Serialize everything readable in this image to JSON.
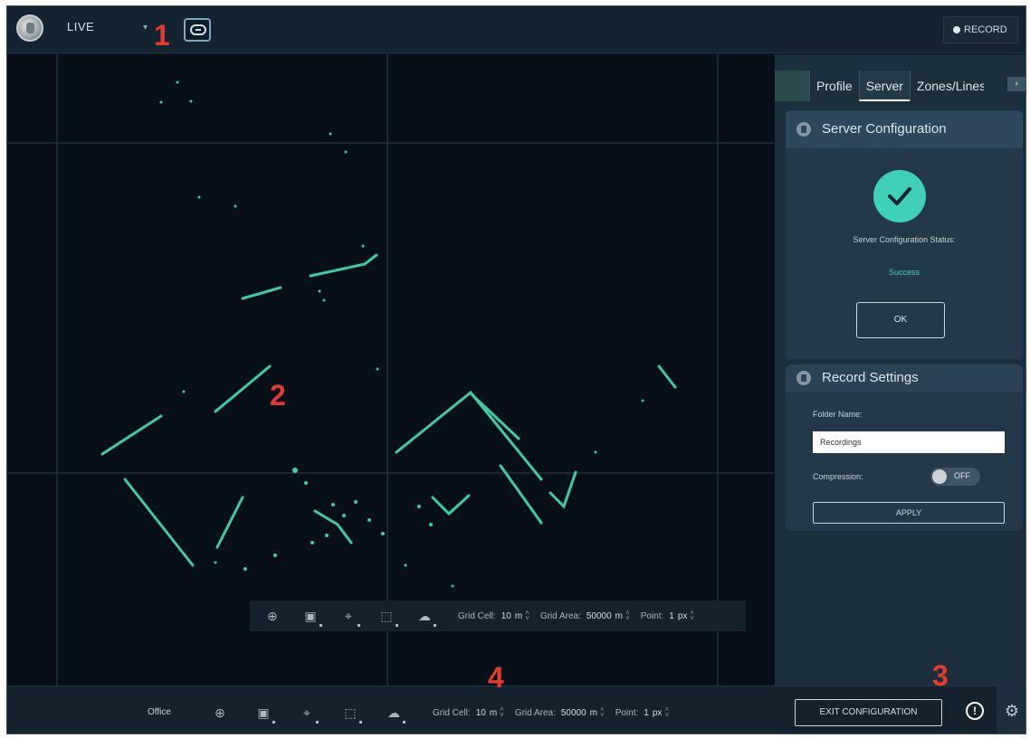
{
  "topbar": {
    "mode_label": "LIVE",
    "record_label": "RECORD"
  },
  "tabs": [
    {
      "label": "Profile"
    },
    {
      "label": "Server"
    },
    {
      "label": "Zones/Lines"
    }
  ],
  "server_config": {
    "title": "Server Configuration",
    "status_label": "Server Configuration Status:",
    "status_value": "Success",
    "ok_label": "OK"
  },
  "record_settings": {
    "title": "Record Settings",
    "folder_label": "Folder Name:",
    "folder_value": "Recordings",
    "compression_label": "Compression:",
    "compression_state": "OFF",
    "apply_label": "APPLY"
  },
  "map_toolbar": {
    "grid_cell_label": "Grid Cell:",
    "grid_cell_value": "10",
    "grid_cell_unit": "m",
    "grid_area_label": "Grid Area:",
    "grid_area_value": "50000",
    "grid_area_unit": "m",
    "point_label": "Point:",
    "point_value": "1",
    "point_unit": "px"
  },
  "bottombar": {
    "location": "Office",
    "grid_cell_label": "Grid Cell:",
    "grid_cell_value": "10",
    "grid_cell_unit": "m",
    "grid_area_label": "Grid Area:",
    "grid_area_value": "50000",
    "grid_area_unit": "m",
    "point_label": "Point:",
    "point_value": "1",
    "point_unit": "px",
    "exit_label": "EXIT CONFIGURATION"
  },
  "annotations": [
    "1",
    "2",
    "3",
    "4"
  ],
  "colors": {
    "accent": "#3ed1b5",
    "point_cloud": "#3ec9a8",
    "background": "#0c1822"
  }
}
